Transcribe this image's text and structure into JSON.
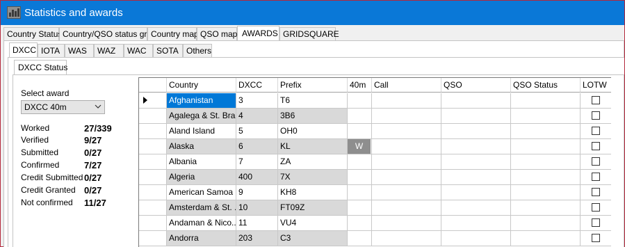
{
  "window": {
    "title": "Statistics and awards"
  },
  "main_tabs": [
    {
      "label": "Country Status"
    },
    {
      "label": "Country/QSO status grid"
    },
    {
      "label": "Country map"
    },
    {
      "label": "QSO map"
    },
    {
      "label": "AWARDS"
    },
    {
      "label": "GRIDSQUARE"
    }
  ],
  "award_tabs": [
    {
      "label": "DXCC"
    },
    {
      "label": "IOTA"
    },
    {
      "label": "WAS"
    },
    {
      "label": "WAZ"
    },
    {
      "label": "WAC"
    },
    {
      "label": "SOTA"
    },
    {
      "label": "Others"
    }
  ],
  "sub_tabs": [
    {
      "label": "DXCC Status"
    }
  ],
  "award_select": {
    "label": "Select award",
    "value": "DXCC 40m"
  },
  "stats": [
    {
      "label": "Worked",
      "value": "27/339"
    },
    {
      "label": "Verified",
      "value": "9/27"
    },
    {
      "label": "Submitted",
      "value": "0/27"
    },
    {
      "label": "Confirmed",
      "value": "7/27"
    },
    {
      "label": "Credit Submitted",
      "value": "0/27"
    },
    {
      "label": "Credit Granted",
      "value": "0/27"
    },
    {
      "label": "Not confirmed",
      "value": "11/27"
    }
  ],
  "grid": {
    "columns": [
      "Country",
      "DXCC",
      "Prefix",
      "40m",
      "Call",
      "QSO",
      "QSO Status",
      "LOTW"
    ],
    "rows": [
      {
        "country": "Afghanistan",
        "dxcc": "3",
        "prefix": "T6",
        "band": "",
        "call": "",
        "qso": "",
        "status": "",
        "lotw": false
      },
      {
        "country": "Agalega & St. Bra...",
        "dxcc": "4",
        "prefix": "3B6",
        "band": "",
        "call": "",
        "qso": "",
        "status": "",
        "lotw": false
      },
      {
        "country": "Aland Island",
        "dxcc": "5",
        "prefix": "OH0",
        "band": "",
        "call": "",
        "qso": "",
        "status": "",
        "lotw": false
      },
      {
        "country": "Alaska",
        "dxcc": "6",
        "prefix": "KL",
        "band": "W",
        "call": "",
        "qso": "",
        "status": "",
        "lotw": false
      },
      {
        "country": "Albania",
        "dxcc": "7",
        "prefix": "ZA",
        "band": "",
        "call": "",
        "qso": "",
        "status": "",
        "lotw": false
      },
      {
        "country": "Algeria",
        "dxcc": "400",
        "prefix": "7X",
        "band": "",
        "call": "",
        "qso": "",
        "status": "",
        "lotw": false
      },
      {
        "country": "American Samoa",
        "dxcc": "9",
        "prefix": "KH8",
        "band": "",
        "call": "",
        "qso": "",
        "status": "",
        "lotw": false
      },
      {
        "country": "Amsterdam & St. ...",
        "dxcc": "10",
        "prefix": "FT09Z",
        "band": "",
        "call": "",
        "qso": "",
        "status": "",
        "lotw": false
      },
      {
        "country": "Andaman & Nico...",
        "dxcc": "11",
        "prefix": "VU4",
        "band": "",
        "call": "",
        "qso": "",
        "status": "",
        "lotw": false
      },
      {
        "country": "Andorra",
        "dxcc": "203",
        "prefix": "C3",
        "band": "",
        "call": "",
        "qso": "",
        "status": "",
        "lotw": false
      }
    ]
  },
  "colors": {
    "titlebar": "#0a78d7",
    "selection": "#0078d7",
    "worked_badge": "#8e8e8e",
    "window_border": "#b4283c"
  }
}
